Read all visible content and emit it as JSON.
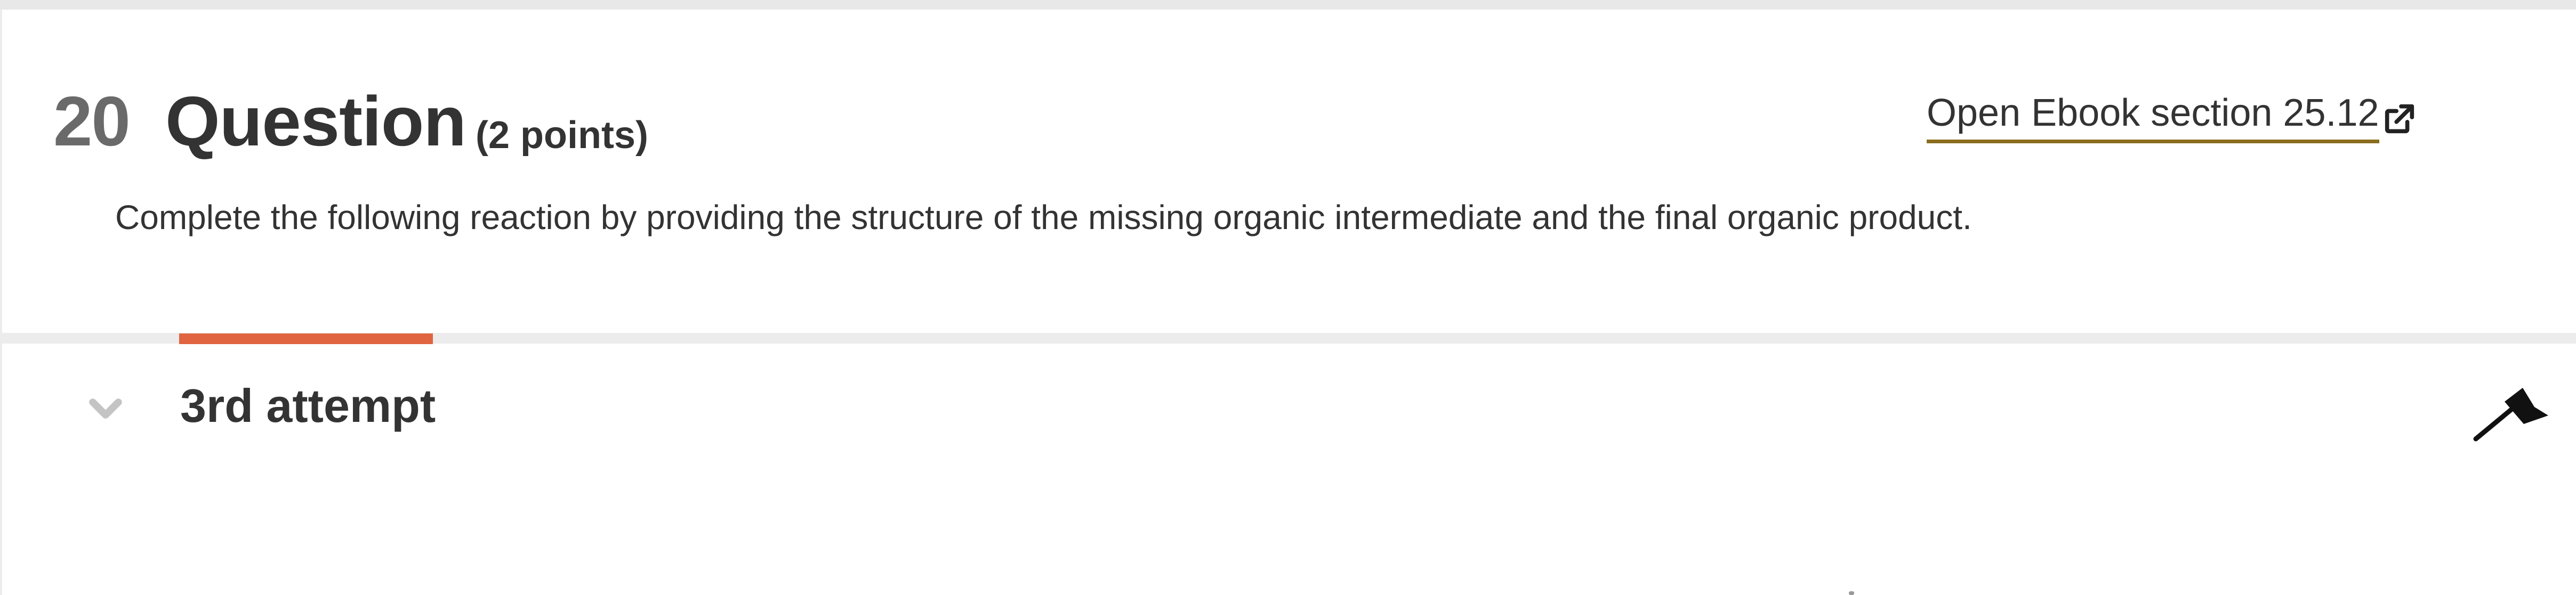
{
  "question": {
    "number": "20",
    "title": "Question",
    "points": "(2 points)",
    "prompt": "Complete the following reaction by providing the structure of the missing organic intermediate and the final organic product.",
    "ebook_link": "Open Ebook section 25.12"
  },
  "attempt": {
    "label": "3rd attempt"
  },
  "colors": {
    "accent_bar": "#e0643f",
    "link_underline": "#8a6d1e",
    "number_gray": "#6a6a6a",
    "page_background": "#ececec"
  },
  "icons": {
    "ebook_external": "external-link-icon",
    "attempt_toggle": "chevron-down-icon",
    "flag": "flag-icon"
  }
}
